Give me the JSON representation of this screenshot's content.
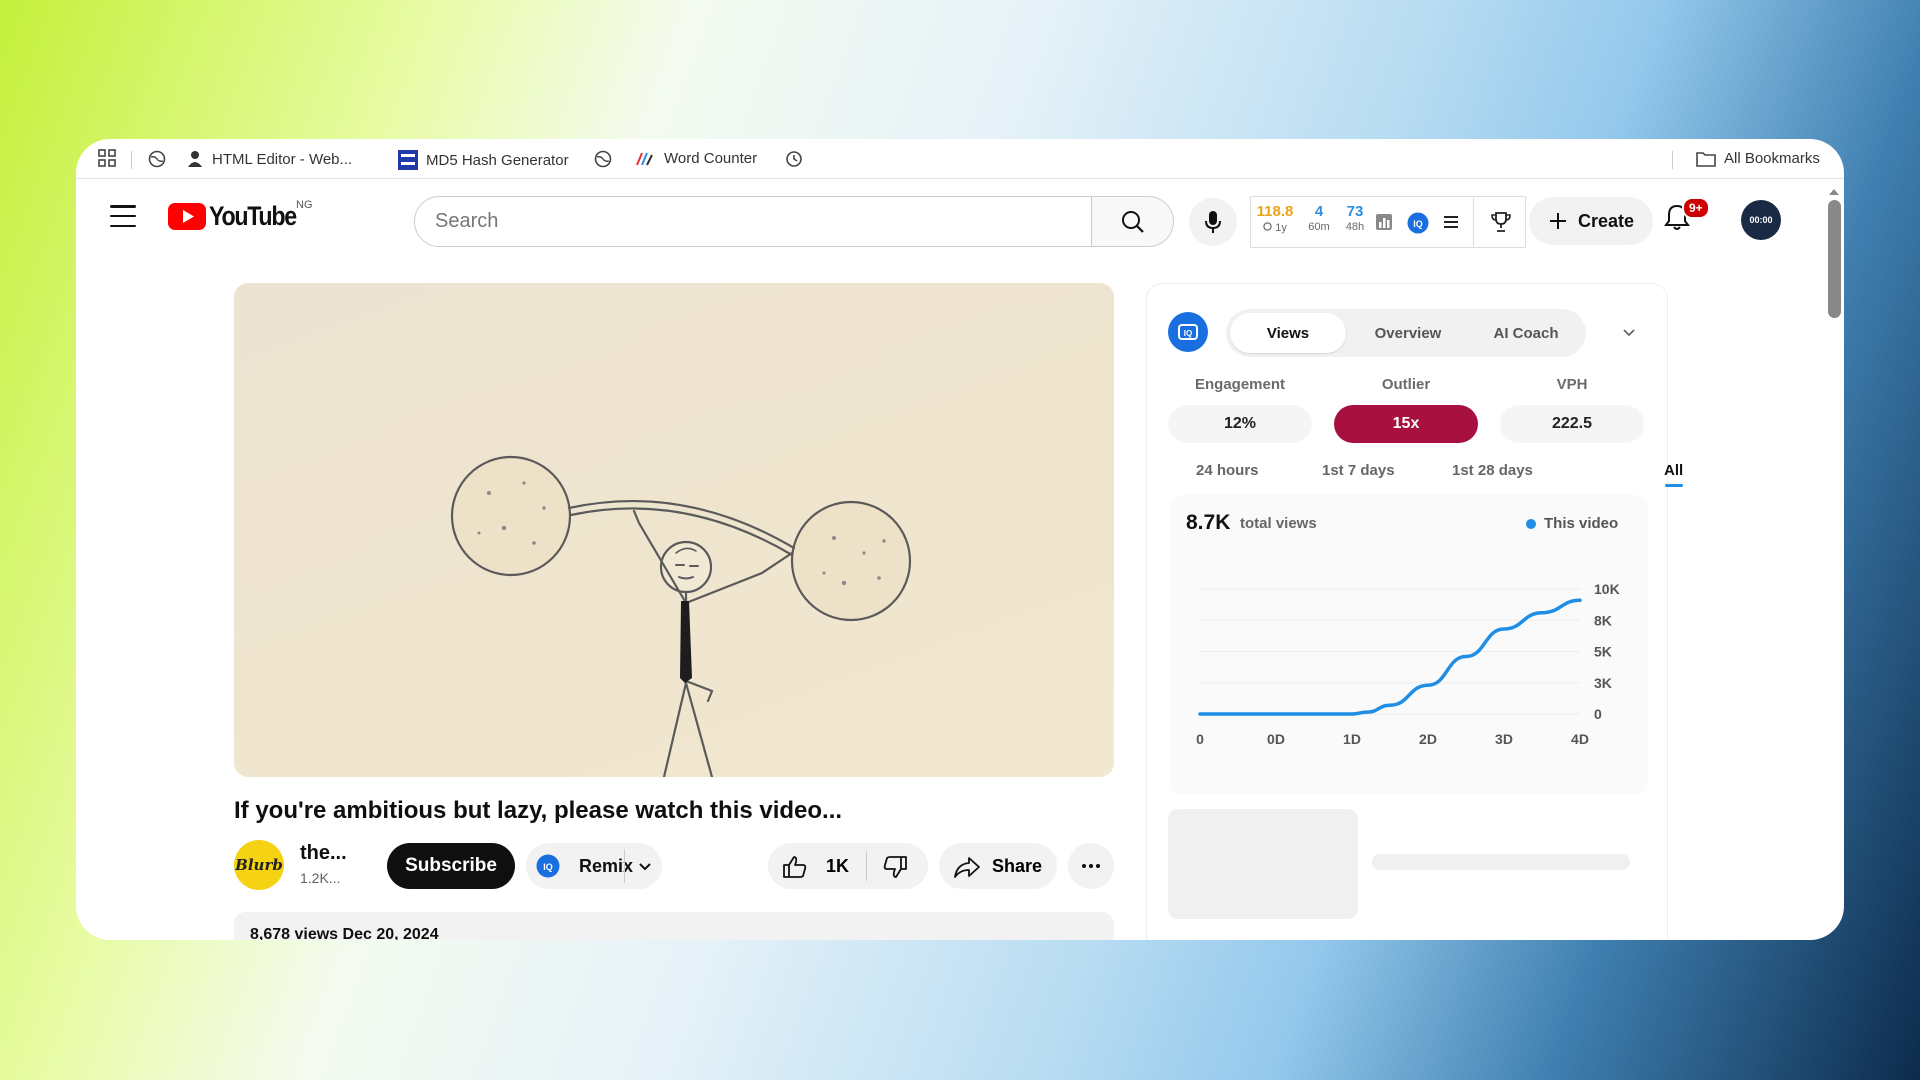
{
  "bookmarks": {
    "items": [
      {
        "label": "HTML Editor - Web..."
      },
      {
        "label": "MD5 Hash Generator"
      },
      {
        "label": "Word Counter"
      }
    ],
    "all_label": "All Bookmarks"
  },
  "header": {
    "logo_text": "YouTube",
    "country_code": "NG",
    "search_placeholder": "Search",
    "ext_stats": [
      {
        "value": "118.8",
        "sub": "1y",
        "color": "#e8a317"
      },
      {
        "value": "4",
        "sub": "60m",
        "color": "#2a8fe0"
      },
      {
        "value": "73",
        "sub": "48h",
        "color": "#2a8fe0"
      }
    ],
    "create_label": "Create",
    "notifications_badge": "9+",
    "avatar_text": "00:00"
  },
  "video": {
    "title": "If you're ambitious but lazy, please watch this video...",
    "channel_avatar_text": "Blurb",
    "channel_name": "the...",
    "channel_subs": "1.2K...",
    "subscribe_label": "Subscribe",
    "remix_label": "Remix",
    "like_count": "1K",
    "share_label": "Share",
    "description_preview": "8,678 views  Dec 20, 2024"
  },
  "panel": {
    "tabs": [
      {
        "label": "Views",
        "active": true
      },
      {
        "label": "Overview",
        "active": false
      },
      {
        "label": "AI Coach",
        "active": false
      }
    ],
    "metrics": [
      {
        "label": "Engagement",
        "value": "12%"
      },
      {
        "label": "Outlier",
        "value": "15x",
        "highlight_color": "#a8103f"
      },
      {
        "label": "VPH",
        "value": "222.5"
      }
    ],
    "ranges": [
      "24 hours",
      "1st 7 days",
      "1st 28 days",
      "All"
    ],
    "active_range": "All",
    "total_views_value": "8.7K",
    "total_views_label": "total views",
    "legend_label": "This video"
  },
  "chart_data": {
    "type": "line",
    "x_ticks": [
      "0",
      "0D",
      "1D",
      "2D",
      "3D",
      "4D"
    ],
    "y_ticks": [
      "10K",
      "8K",
      "5K",
      "3K",
      "0"
    ],
    "ylim": [
      0,
      10000
    ],
    "xlim": [
      -1,
      4
    ],
    "series": [
      {
        "name": "This video",
        "color": "#1e8ee6",
        "x": [
          -1,
          0,
          0.5,
          1,
          1.2,
          1.5,
          2,
          2.5,
          3,
          3.5,
          4
        ],
        "y": [
          0,
          0,
          0,
          0,
          150,
          700,
          2300,
          4600,
          6800,
          8100,
          9100
        ]
      }
    ]
  }
}
